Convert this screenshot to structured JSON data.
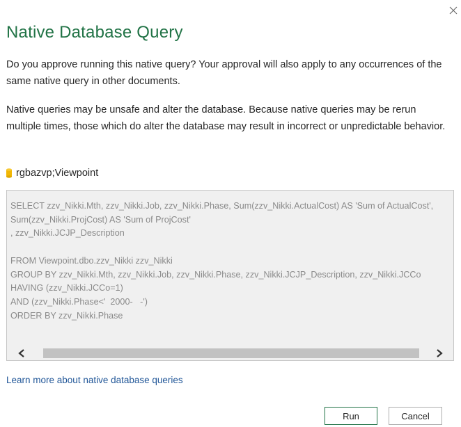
{
  "dialog": {
    "title": "Native Database Query",
    "close_icon": "close-icon",
    "approval_text": "Do you approve running this native query? Your approval will also apply to any occurrences of the same native query in other documents.",
    "warning_text": "Native queries may be unsafe and alter the database. Because native queries may be rerun multiple times, those which do alter the database may result in incorrect or unpredictable behavior.",
    "source": {
      "icon": "database-icon",
      "label": "rgbazvp;Viewpoint"
    },
    "query": "SELECT zzv_Nikki.Mth, zzv_Nikki.Job, zzv_Nikki.Phase, Sum(zzv_Nikki.ActualCost) AS 'Sum of ActualCost',\nSum(zzv_Nikki.ProjCost) AS 'Sum of ProjCost'\n, zzv_Nikki.JCJP_Description\n\nFROM Viewpoint.dbo.zzv_Nikki zzv_Nikki\nGROUP BY zzv_Nikki.Mth, zzv_Nikki.Job, zzv_Nikki.Phase, zzv_Nikki.JCJP_Description, zzv_Nikki.JCCo\nHAVING (zzv_Nikki.JCCo=1)\nAND (zzv_Nikki.Phase<'  2000-   -')\nORDER BY zzv_Nikki.Phase",
    "scrollbar": {
      "left_icon": "chevron-left-icon",
      "right_icon": "chevron-right-icon"
    },
    "learn_more_link": "Learn more about native database queries",
    "buttons": {
      "run": "Run",
      "cancel": "Cancel"
    },
    "colors": {
      "title": "#217346",
      "link": "#1f5597",
      "database_icon": "#f2b705",
      "query_background": "#f0f0f0"
    }
  }
}
